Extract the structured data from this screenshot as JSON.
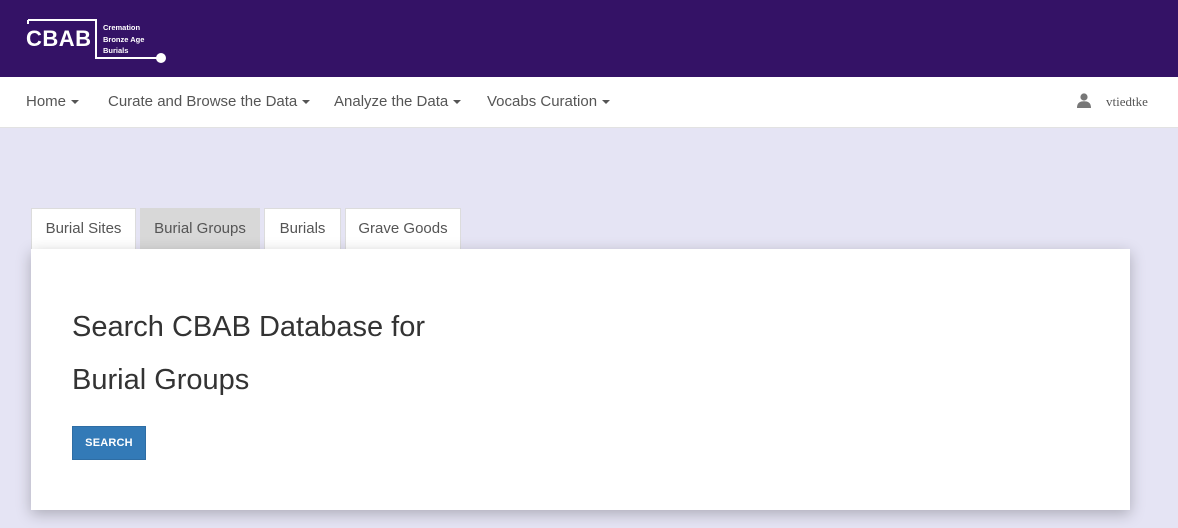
{
  "brand": {
    "abbr": "CBAB",
    "line1": "Cremation",
    "line2": "Bronze Age",
    "line3": "Burials"
  },
  "nav": {
    "items": [
      {
        "label": "Home"
      },
      {
        "label": "Curate and Browse the Data"
      },
      {
        "label": "Analyze the Data"
      },
      {
        "label": "Vocabs Curation"
      }
    ],
    "user": "vtiedtke"
  },
  "tabs": [
    {
      "label": "Burial Sites",
      "active": false
    },
    {
      "label": "Burial Groups",
      "active": true
    },
    {
      "label": "Burials",
      "active": false
    },
    {
      "label": "Grave Goods",
      "active": false
    }
  ],
  "panel": {
    "title_line1": "Search CBAB Database for",
    "title_line2": "Burial Groups",
    "search_label": "SEARCH"
  },
  "colors": {
    "header_bg": "#341266",
    "page_bg": "#e5e4f4",
    "button_bg": "#337ab7"
  },
  "icons": {
    "user": "user-icon",
    "caret": "caret-down-icon"
  }
}
